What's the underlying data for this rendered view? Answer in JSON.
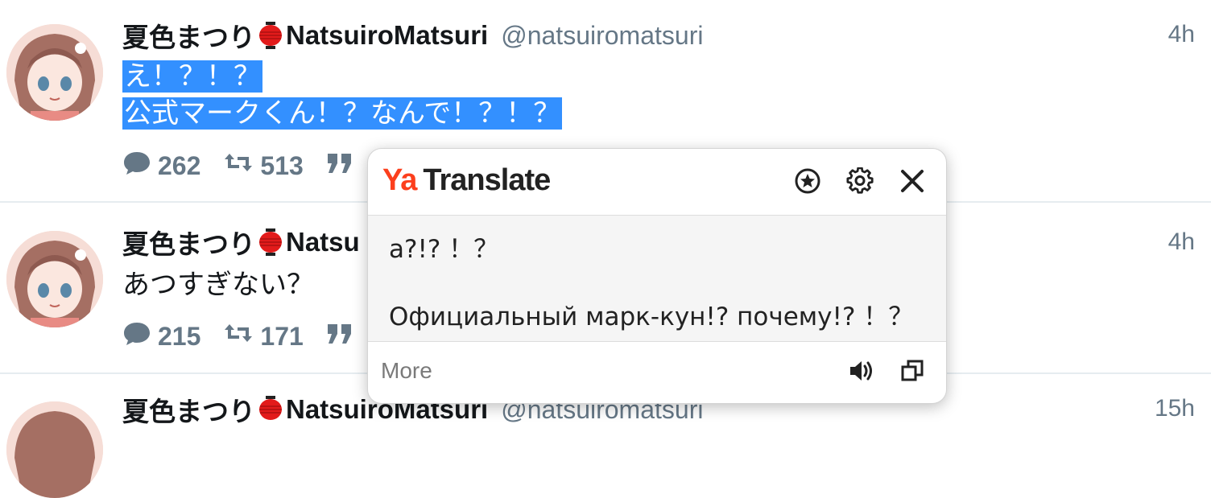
{
  "tweets": [
    {
      "name": "夏色まつり",
      "name_suffix": "NatsuiroMatsuri",
      "handle": "@natsuiromatsuri",
      "time": "4h",
      "lines": [
        "え！？！？",
        "公式マークくん！？なんで！？！？"
      ],
      "replies": "262",
      "retweets": "513"
    },
    {
      "name": "夏色まつり",
      "name_suffix": "Natsu",
      "time": "4h",
      "lines": [
        "あつすぎない？"
      ],
      "replies": "215",
      "retweets": "171"
    },
    {
      "name": "夏色まつり",
      "name_suffix": "NatsuiroMatsuri",
      "handle": "@natsuiromatsuri",
      "time": "15h"
    }
  ],
  "translate_popup": {
    "logo_ya": "Ya",
    "logo_translate": "Translate",
    "lines": [
      "а?!? ！？",
      "Официальный марк-кун!? почему!? ！？"
    ],
    "more_label": "More"
  },
  "colors": {
    "selection": "#3390ff",
    "muted": "#657786",
    "yandex_red": "#fc3f1d",
    "lantern": "#e21b1b"
  },
  "icons": [
    "reply-icon",
    "retweet-icon",
    "quote-icon",
    "lantern-icon",
    "favorite-star-icon",
    "gear-icon",
    "close-icon",
    "speaker-icon",
    "copy-icon"
  ]
}
